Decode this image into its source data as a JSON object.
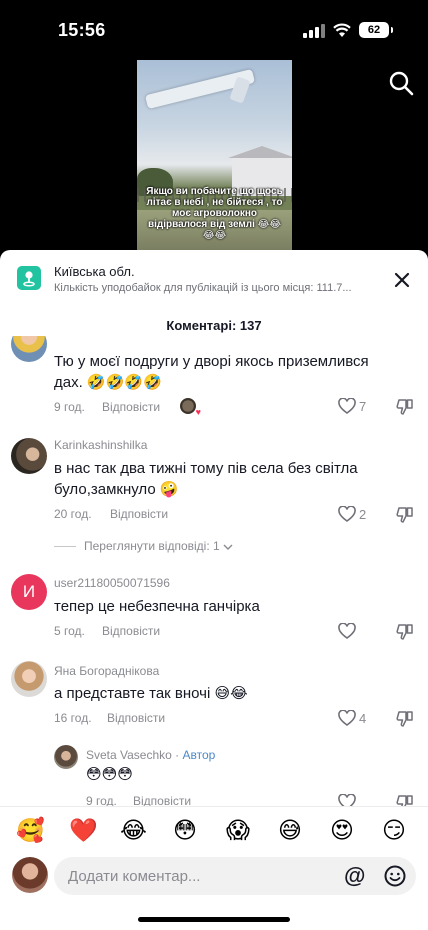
{
  "status": {
    "time": "15:56",
    "battery": "62"
  },
  "video": {
    "caption": "Якщо ви побачите що щось літає в небі , не бійтеся , то моє агроволокно відірвалося від землі 😂😂😂😂"
  },
  "location": {
    "title": "Київська обл.",
    "subtitle": "Кількість уподобайок для публікацій із цього місця: 111.7..."
  },
  "comments_header": {
    "label": "Коментарі:",
    "count": "137"
  },
  "comments": [
    {
      "name": "",
      "text": "Тю у моєї подруги у дворі якось приземлився дах. 🤣🤣🤣🤣",
      "time": "9 год.",
      "reply": "Відповісти",
      "likes": "7"
    },
    {
      "name": "Karinkashinshilka",
      "text": "в нас так два тижні тому пів села без світла було,замкнуло 🤪",
      "time": "20 год.",
      "reply": "Відповісти",
      "likes": "2"
    },
    {
      "name": "user21180050071596",
      "avatar_letter": "И",
      "text": "тепер це небезпечна ганчірка",
      "time": "5 год.",
      "reply": "Відповісти",
      "likes": ""
    },
    {
      "name": "Яна Богораднікова",
      "text": "а представте так вночі 😅😂",
      "time": "16 год.",
      "reply": "Відповісти",
      "likes": "4"
    }
  ],
  "view_replies": "Переглянути відповіді: 1",
  "reply": {
    "name": "Sveta Vasechko",
    "separator": "·",
    "author": "Автор",
    "text": "😳😳😳",
    "time": "9 год.",
    "reply": "Відповісти"
  },
  "emojis": [
    "🥰",
    "❤️",
    "😂",
    "😳",
    "😱",
    "😅",
    "😍",
    "😏"
  ],
  "input": {
    "placeholder": "Додати коментар...",
    "at": "@"
  },
  "colors": {
    "accent": "#4a89c8",
    "location_icon": "#22c3a0",
    "avatar_letter_bg": "#e8365d"
  }
}
